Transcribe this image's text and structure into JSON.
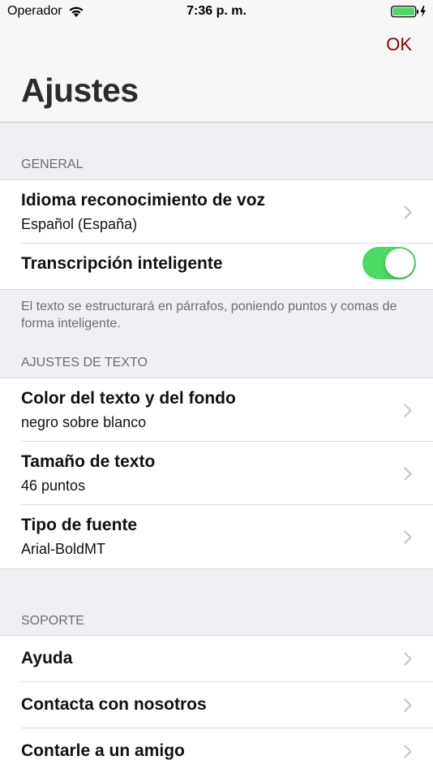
{
  "status_bar": {
    "carrier": "Operador",
    "time": "7:36 p. m.",
    "battery_color": "#4cd964"
  },
  "nav": {
    "ok_label": "OK",
    "title": "Ajustes"
  },
  "sections": {
    "general": {
      "header": "GENERAL",
      "language": {
        "title": "Idioma reconocimiento de voz",
        "value": "Español (España)"
      },
      "smart": {
        "title": "Transcripción inteligente",
        "enabled": true
      },
      "footer": "El texto se estructurará en párrafos, poniendo puntos y comas de forma inteligente."
    },
    "text": {
      "header": "AJUSTES DE TEXTO",
      "color": {
        "title": "Color del texto y del fondo",
        "value": "negro sobre blanco"
      },
      "size": {
        "title": "Tamaño de texto",
        "value": "46 puntos"
      },
      "font": {
        "title": "Tipo de fuente",
        "value": "Arial-BoldMT"
      }
    },
    "support": {
      "header": "SOPORTE",
      "help": "Ayuda",
      "contact": "Contacta con nosotros",
      "share": "Contarle a un amigo"
    }
  },
  "colors": {
    "accent": "#8b0000",
    "toggle_on": "#4cd964",
    "background": "#efeff4"
  },
  "icons": {
    "wifi": "wifi-icon",
    "battery": "battery-icon",
    "charging": "charging-bolt-icon",
    "chevron": "chevron-right-icon"
  }
}
